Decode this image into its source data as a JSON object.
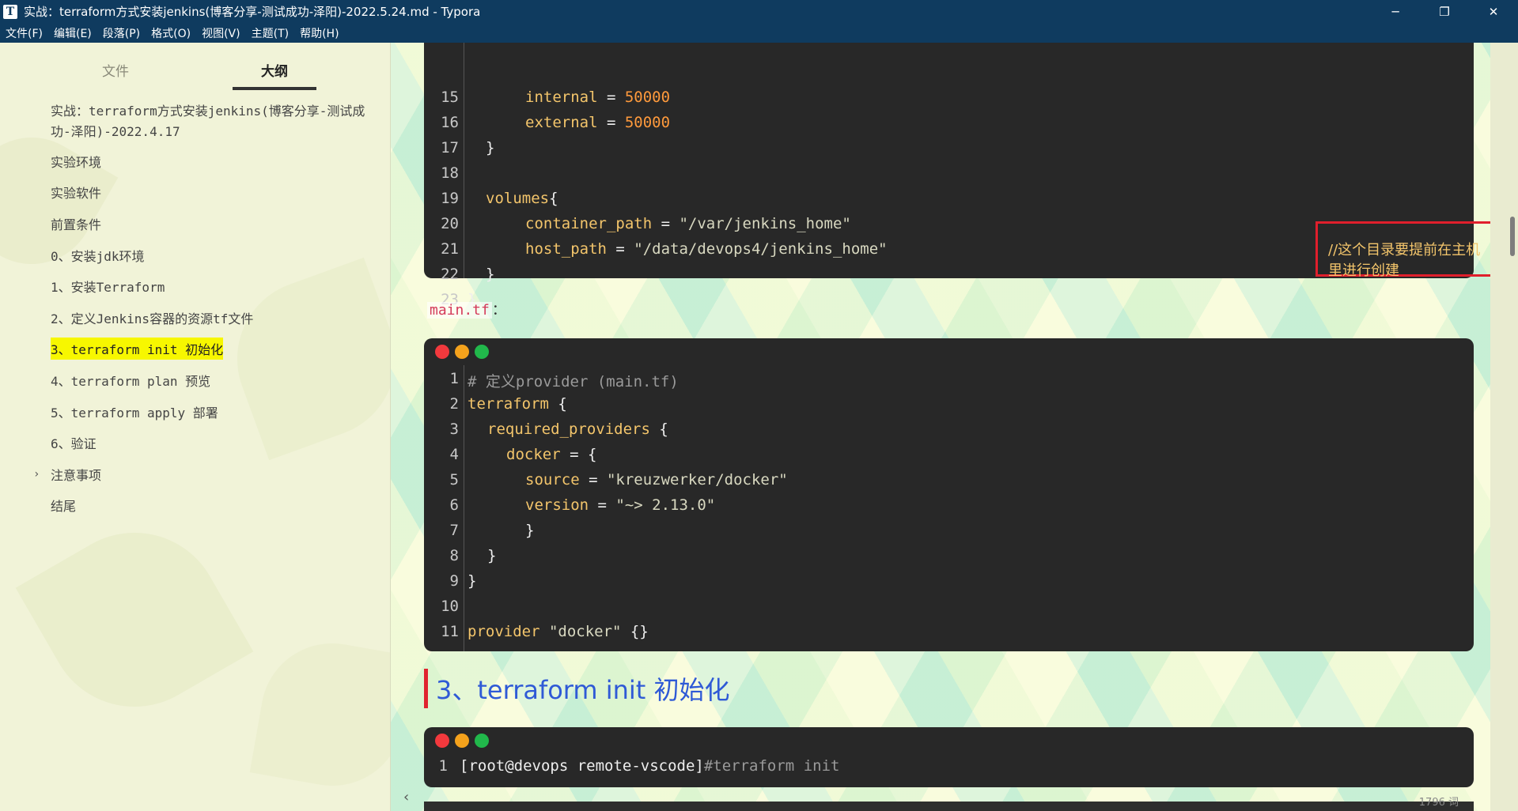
{
  "window": {
    "app_icon": "T",
    "title": "实战：terraform方式安装jenkins(博客分享-测试成功-泽阳)-2022.5.24.md - Typora",
    "minimize": "─",
    "restore": "❐",
    "close": "✕"
  },
  "menu": [
    "文件(F)",
    "编辑(E)",
    "段落(P)",
    "格式(O)",
    "视图(V)",
    "主题(T)",
    "帮助(H)"
  ],
  "sidebar": {
    "tabs": [
      "文件",
      "大纲"
    ],
    "active_tab": "大纲",
    "outline": [
      "实战：terraform方式安装jenkins(博客分享-测试成功-泽阳)-2022.4.17",
      "实验环境",
      "实验软件",
      "前置条件",
      "0、安装jdk环境",
      "1、安装Terraform",
      "2、定义Jenkins容器的资源tf文件",
      "3、terraform init 初始化",
      "4、terraform plan 预览",
      "5、terraform apply 部署",
      "6、验证",
      "注意事项",
      "结尾"
    ],
    "current_index": 7,
    "collapsed_caret": "›"
  },
  "code_block_1": {
    "line_numbers": [
      "15",
      "16",
      "17",
      "18",
      "19",
      "20",
      "21",
      "22",
      "23"
    ]
  },
  "code1": {
    "l15a": "internal",
    "l15b": " = ",
    "l15c": "50000",
    "l16a": "external",
    "l16b": " = ",
    "l16c": "50000",
    "l17": "}",
    "l19a": "volumes",
    "l19b": "{",
    "l20a": "container_path",
    "l20b": " = ",
    "l20c": "\"/var/jenkins_home\"",
    "l21a": "host_path",
    "l21b": " = ",
    "l21c": "\"/data/devops4/jenkins_home\"",
    "l22": "}",
    "l23": "}"
  },
  "annotation_text": "//这个目录要提前在主机里进行创建",
  "inline_file": "main.tf",
  "inline_colon": "：",
  "code_block_2": {
    "line_numbers": [
      "1",
      "2",
      "3",
      "4",
      "5",
      "6",
      "7",
      "8",
      "9",
      "10",
      "11"
    ]
  },
  "code2": {
    "l1": "# 定义provider (main.tf)",
    "l2a": "terraform",
    "l2b": " {",
    "l3a": "required_providers",
    "l3b": " {",
    "l4a": "docker",
    "l4b": " = {",
    "l5a": "source",
    "l5b": " = ",
    "l5c": "\"kreuzwerker/docker\"",
    "l6a": "version",
    "l6b": " = ",
    "l6c": "\"~> 2.13.0\"",
    "l7": "}",
    "l8": "}",
    "l9": "}",
    "l11a": "provider",
    "l11b": " \"docker\"",
    "l11c": " {}"
  },
  "heading": "3、terraform init  初始化",
  "code_block_3": {
    "line_numbers": [
      "1"
    ],
    "prompt": "[root@devops remote-vscode]",
    "command": "#terraform init"
  },
  "footer": {
    "scroll_arrow": "‹",
    "wordcount": "1796 词"
  },
  "colors": {
    "titlebar": "#0f3b5f",
    "highlight": "#f7f700",
    "annotation_border": "#e01f2c",
    "heading": "#2f5ad6",
    "code_bg": "#282828"
  }
}
